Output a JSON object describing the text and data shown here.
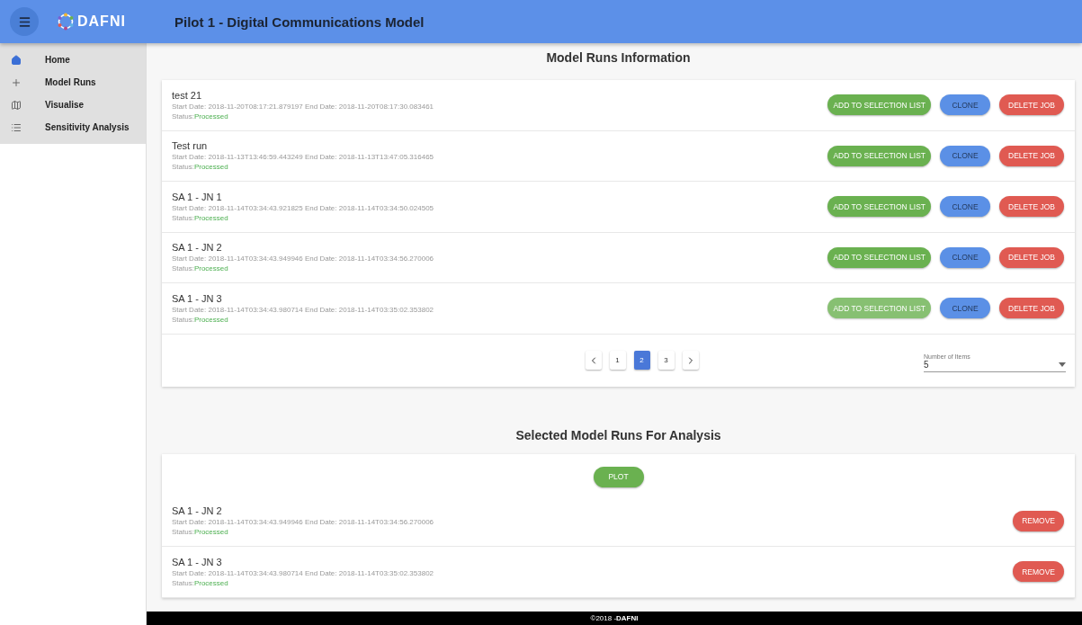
{
  "header": {
    "logo_text": "DAFNI",
    "title": "Pilot 1 - Digital Communications Model"
  },
  "sidebar": {
    "items": [
      {
        "label": "Home",
        "selected": false
      },
      {
        "label": "Model Runs",
        "selected": false
      },
      {
        "label": "Visualise",
        "selected": false
      },
      {
        "label": "Sensitivity Analysis",
        "selected": false
      }
    ]
  },
  "model_runs": {
    "heading": "Model Runs Information",
    "rows": [
      {
        "name": "test 21",
        "dates": "Start Date: 2018-11-20T08:17:21.879197 End Date: 2018-11-20T08:17:30.083461",
        "status_label": "Status:",
        "status": "Processed",
        "buttons": [
          {
            "label": "ADD TO SELECTION LIST",
            "kind": "add",
            "dimmed": false
          },
          {
            "label": "CLONE",
            "kind": "clone",
            "dimmed": false
          },
          {
            "label": "DELETE JOB",
            "kind": "delete",
            "dimmed": false
          }
        ]
      },
      {
        "name": "Test run",
        "dates": "Start Date: 2018-11-13T13:46:59.443249 End Date: 2018-11-13T13:47:05.316465",
        "status_label": "Status:",
        "status": "Processed",
        "buttons": [
          {
            "label": "ADD TO SELECTION LIST",
            "kind": "add",
            "dimmed": false
          },
          {
            "label": "CLONE",
            "kind": "clone",
            "dimmed": false
          },
          {
            "label": "DELETE JOB",
            "kind": "delete",
            "dimmed": false
          }
        ]
      },
      {
        "name": "SA 1 - JN 1",
        "dates": "Start Date: 2018-11-14T03:34:43.921825 End Date: 2018-11-14T03:34:50.024505",
        "status_label": "Status:",
        "status": "Processed",
        "buttons": [
          {
            "label": "ADD TO SELECTION LIST",
            "kind": "add",
            "dimmed": false
          },
          {
            "label": "CLONE",
            "kind": "clone",
            "dimmed": false
          },
          {
            "label": "DELETE JOB",
            "kind": "delete",
            "dimmed": false
          }
        ]
      },
      {
        "name": "SA 1 - JN 2",
        "dates": "Start Date: 2018-11-14T03:34:43.949946 End Date: 2018-11-14T03:34:56.270006",
        "status_label": "Status:",
        "status": "Processed",
        "buttons": [
          {
            "label": "ADD TO SELECTION LIST",
            "kind": "add",
            "dimmed": false
          },
          {
            "label": "CLONE",
            "kind": "clone",
            "dimmed": false
          },
          {
            "label": "DELETE JOB",
            "kind": "delete",
            "dimmed": false
          }
        ]
      },
      {
        "name": "SA 1 - JN 3",
        "dates": "Start Date: 2018-11-14T03:34:43.980714 End Date: 2018-11-14T03:35:02.353802",
        "status_label": "Status:",
        "status": "Processed",
        "buttons": [
          {
            "label": "ADD TO SELECTION LIST",
            "kind": "add",
            "dimmed": true
          },
          {
            "label": "CLONE",
            "kind": "clone",
            "dimmed": false
          },
          {
            "label": "DELETE JOB",
            "kind": "delete",
            "dimmed": false
          }
        ]
      }
    ],
    "pagination": {
      "pages": [
        {
          "label": "1",
          "selected": false
        },
        {
          "label": "2",
          "selected": true
        },
        {
          "label": "3",
          "selected": false
        }
      ]
    },
    "items_select": {
      "label": "Number of Items",
      "value": "5"
    }
  },
  "selected_runs": {
    "heading": "Selected Model Runs For Analysis",
    "plot_button": "PLOT",
    "rows": [
      {
        "name": "SA 1 - JN 2",
        "dates": "Start Date: 2018-11-14T03:34:43.949946 End Date: 2018-11-14T03:34:56.270006",
        "status_label": "Status:",
        "status": "Processed",
        "button": "REMOVE"
      },
      {
        "name": "SA 1 - JN 3",
        "dates": "Start Date: 2018-11-14T03:34:43.980714 End Date: 2018-11-14T03:35:02.353802",
        "status_label": "Status:",
        "status": "Processed",
        "button": "REMOVE"
      }
    ]
  },
  "footer": {
    "text": "©2018 -**DAFNI**"
  }
}
